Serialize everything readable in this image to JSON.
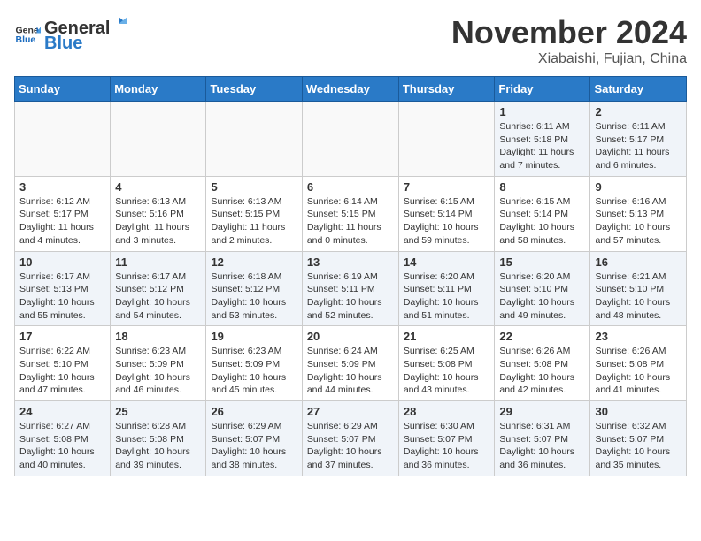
{
  "header": {
    "logo_general": "General",
    "logo_blue": "Blue",
    "month_title": "November 2024",
    "subtitle": "Xiabaishi, Fujian, China"
  },
  "calendar": {
    "headers": [
      "Sunday",
      "Monday",
      "Tuesday",
      "Wednesday",
      "Thursday",
      "Friday",
      "Saturday"
    ],
    "rows": [
      [
        {
          "day": "",
          "info": ""
        },
        {
          "day": "",
          "info": ""
        },
        {
          "day": "",
          "info": ""
        },
        {
          "day": "",
          "info": ""
        },
        {
          "day": "",
          "info": ""
        },
        {
          "day": "1",
          "info": "Sunrise: 6:11 AM\nSunset: 5:18 PM\nDaylight: 11 hours\nand 7 minutes."
        },
        {
          "day": "2",
          "info": "Sunrise: 6:11 AM\nSunset: 5:17 PM\nDaylight: 11 hours\nand 6 minutes."
        }
      ],
      [
        {
          "day": "3",
          "info": "Sunrise: 6:12 AM\nSunset: 5:17 PM\nDaylight: 11 hours\nand 4 minutes."
        },
        {
          "day": "4",
          "info": "Sunrise: 6:13 AM\nSunset: 5:16 PM\nDaylight: 11 hours\nand 3 minutes."
        },
        {
          "day": "5",
          "info": "Sunrise: 6:13 AM\nSunset: 5:15 PM\nDaylight: 11 hours\nand 2 minutes."
        },
        {
          "day": "6",
          "info": "Sunrise: 6:14 AM\nSunset: 5:15 PM\nDaylight: 11 hours\nand 0 minutes."
        },
        {
          "day": "7",
          "info": "Sunrise: 6:15 AM\nSunset: 5:14 PM\nDaylight: 10 hours\nand 59 minutes."
        },
        {
          "day": "8",
          "info": "Sunrise: 6:15 AM\nSunset: 5:14 PM\nDaylight: 10 hours\nand 58 minutes."
        },
        {
          "day": "9",
          "info": "Sunrise: 6:16 AM\nSunset: 5:13 PM\nDaylight: 10 hours\nand 57 minutes."
        }
      ],
      [
        {
          "day": "10",
          "info": "Sunrise: 6:17 AM\nSunset: 5:13 PM\nDaylight: 10 hours\nand 55 minutes."
        },
        {
          "day": "11",
          "info": "Sunrise: 6:17 AM\nSunset: 5:12 PM\nDaylight: 10 hours\nand 54 minutes."
        },
        {
          "day": "12",
          "info": "Sunrise: 6:18 AM\nSunset: 5:12 PM\nDaylight: 10 hours\nand 53 minutes."
        },
        {
          "day": "13",
          "info": "Sunrise: 6:19 AM\nSunset: 5:11 PM\nDaylight: 10 hours\nand 52 minutes."
        },
        {
          "day": "14",
          "info": "Sunrise: 6:20 AM\nSunset: 5:11 PM\nDaylight: 10 hours\nand 51 minutes."
        },
        {
          "day": "15",
          "info": "Sunrise: 6:20 AM\nSunset: 5:10 PM\nDaylight: 10 hours\nand 49 minutes."
        },
        {
          "day": "16",
          "info": "Sunrise: 6:21 AM\nSunset: 5:10 PM\nDaylight: 10 hours\nand 48 minutes."
        }
      ],
      [
        {
          "day": "17",
          "info": "Sunrise: 6:22 AM\nSunset: 5:10 PM\nDaylight: 10 hours\nand 47 minutes."
        },
        {
          "day": "18",
          "info": "Sunrise: 6:23 AM\nSunset: 5:09 PM\nDaylight: 10 hours\nand 46 minutes."
        },
        {
          "day": "19",
          "info": "Sunrise: 6:23 AM\nSunset: 5:09 PM\nDaylight: 10 hours\nand 45 minutes."
        },
        {
          "day": "20",
          "info": "Sunrise: 6:24 AM\nSunset: 5:09 PM\nDaylight: 10 hours\nand 44 minutes."
        },
        {
          "day": "21",
          "info": "Sunrise: 6:25 AM\nSunset: 5:08 PM\nDaylight: 10 hours\nand 43 minutes."
        },
        {
          "day": "22",
          "info": "Sunrise: 6:26 AM\nSunset: 5:08 PM\nDaylight: 10 hours\nand 42 minutes."
        },
        {
          "day": "23",
          "info": "Sunrise: 6:26 AM\nSunset: 5:08 PM\nDaylight: 10 hours\nand 41 minutes."
        }
      ],
      [
        {
          "day": "24",
          "info": "Sunrise: 6:27 AM\nSunset: 5:08 PM\nDaylight: 10 hours\nand 40 minutes."
        },
        {
          "day": "25",
          "info": "Sunrise: 6:28 AM\nSunset: 5:08 PM\nDaylight: 10 hours\nand 39 minutes."
        },
        {
          "day": "26",
          "info": "Sunrise: 6:29 AM\nSunset: 5:07 PM\nDaylight: 10 hours\nand 38 minutes."
        },
        {
          "day": "27",
          "info": "Sunrise: 6:29 AM\nSunset: 5:07 PM\nDaylight: 10 hours\nand 37 minutes."
        },
        {
          "day": "28",
          "info": "Sunrise: 6:30 AM\nSunset: 5:07 PM\nDaylight: 10 hours\nand 36 minutes."
        },
        {
          "day": "29",
          "info": "Sunrise: 6:31 AM\nSunset: 5:07 PM\nDaylight: 10 hours\nand 36 minutes."
        },
        {
          "day": "30",
          "info": "Sunrise: 6:32 AM\nSunset: 5:07 PM\nDaylight: 10 hours\nand 35 minutes."
        }
      ]
    ]
  }
}
